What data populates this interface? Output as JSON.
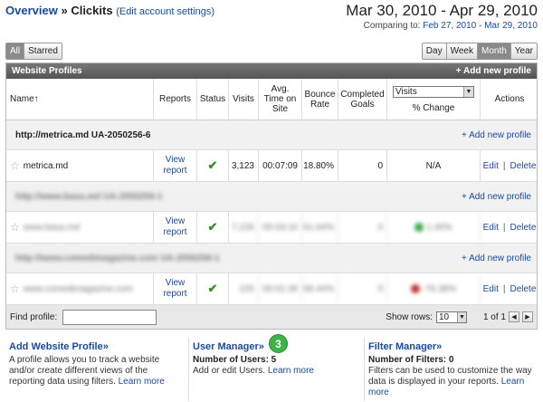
{
  "header": {
    "breadcrumb_root": "Overview",
    "breadcrumb_sep": "»",
    "breadcrumb_current": "Clickits",
    "edit_link": "(Edit account settings)",
    "date_range": "Mar 30, 2010 - Apr 29, 2010",
    "comparing_label": "Comparing to:",
    "comparing_range": "Feb 27, 2010 - Mar 29, 2010"
  },
  "filter_buttons": [
    {
      "label": "All",
      "active": true
    },
    {
      "label": "Starred",
      "active": false
    }
  ],
  "period_buttons": [
    {
      "label": "Day",
      "active": false
    },
    {
      "label": "Week",
      "active": false
    },
    {
      "label": "Month",
      "active": true
    },
    {
      "label": "Year",
      "active": false
    }
  ],
  "table": {
    "title": "Website Profiles",
    "add_profile": "+ Add new profile",
    "columns": {
      "name": "Name↑",
      "reports": "Reports",
      "status": "Status",
      "visits": "Visits",
      "avg_time": "Avg. Time on Site",
      "bounce": "Bounce Rate",
      "goals": "Completed Goals",
      "metric_select": "Visits",
      "change": "% Change",
      "actions": "Actions"
    },
    "groups": [
      {
        "account": "http://metrica.md   UA-2050256-6",
        "blurred": false,
        "add_label": "+ Add new profile",
        "profile": {
          "name": "metrica.md",
          "reports": "View report",
          "visits": "3,123",
          "avg_time": "00:07:09",
          "bounce": "18.80%",
          "goals": "0",
          "change": "N/A",
          "change_color": "",
          "edit": "Edit",
          "delete": "Delete"
        }
      },
      {
        "account": "http://www.basa.md   UA-2050256-1",
        "blurred": true,
        "add_label": "+ Add new profile",
        "profile": {
          "name": "www.basa.md",
          "reports": "View report",
          "visits": "7,226",
          "avg_time": "00:03:10",
          "bounce": "61.64%",
          "goals": "0",
          "change": "1.40%",
          "change_color": "#3aa84a",
          "edit": "Edit",
          "delete": "Delete"
        }
      },
      {
        "account": "http://www.comedimagazine.com   UA-2050256-1",
        "blurred": true,
        "add_label": "+ Add new profile",
        "profile": {
          "name": "www.comedimagazine.com",
          "reports": "View report",
          "visits": "225",
          "avg_time": "00:01:28",
          "bounce": "68.44%",
          "goals": "0",
          "change": "-76.38%",
          "change_color": "#c03030",
          "edit": "Edit",
          "delete": "Delete"
        }
      }
    ],
    "footer": {
      "find_label": "Find profile:",
      "show_rows_label": "Show rows:",
      "rows_value": "10",
      "page_info": "1 of 1"
    }
  },
  "panels": [
    {
      "title": "Add Website Profile»",
      "subtitle": "",
      "desc": "A profile allows you to track a website and/or create different views of the reporting data using filters.",
      "learn_more": "Learn more"
    },
    {
      "title": "User Manager»",
      "subtitle": "Number of Users: 5",
      "desc": "Add or edit Users.",
      "learn_more": "Learn more",
      "badge": "3"
    },
    {
      "title": "Filter Manager»",
      "subtitle": "Number of Filters: 0",
      "desc": "Filters can be used to customize the way data is displayed in your reports.",
      "learn_more": "Learn more"
    }
  ],
  "icons": {
    "star": "star-icon",
    "status_ok": "checkmark-icon",
    "sort": "sort-arrow-icon"
  },
  "colors": {
    "link": "#1a4aa0",
    "table_bar": "#666666",
    "active_button": "#8a8a8a",
    "badge": "#3db34a"
  }
}
